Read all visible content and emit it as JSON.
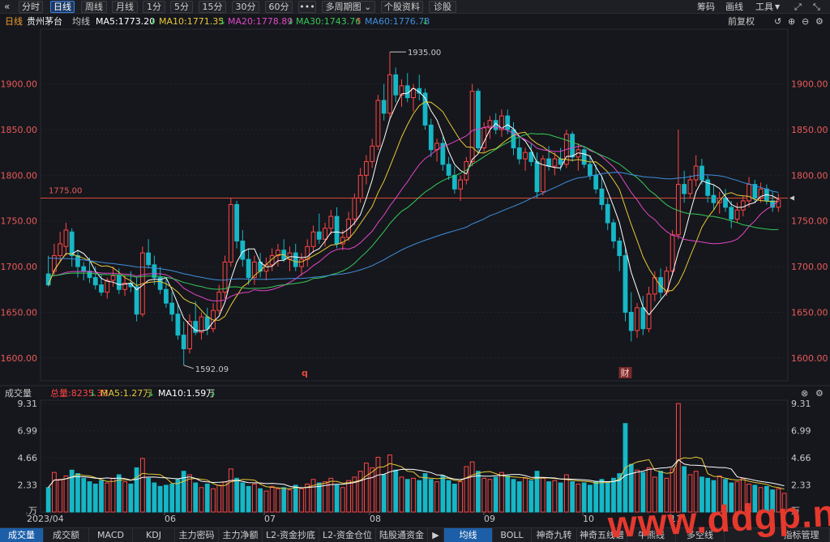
{
  "toolbar": {
    "back": "«",
    "buttons": [
      "分时",
      "日线",
      "周线",
      "月线",
      "1分",
      "5分",
      "15分",
      "30分",
      "60分",
      "•••",
      "多周期图",
      "个股资料",
      "诊股"
    ],
    "multi_arrow": "⌄",
    "right": [
      "筹码",
      "画线",
      "工具"
    ]
  },
  "legend": {
    "period": "日线",
    "name": "贵州茅台",
    "ma_label": "均线",
    "ma5": "MA5:1773.20",
    "ma10": "MA10:1771.35",
    "ma20": "MA20:1778.89",
    "ma30": "MA30:1743.76",
    "ma60": "MA60:1776.78",
    "adjust": "前复权"
  },
  "vol_legend": {
    "title": "成交量",
    "total": "总量:8235.33",
    "ma5": "MA5:1.27万",
    "ma10": "MA10:1.59万"
  },
  "price_axis": [
    "1900.00",
    "1850.00",
    "1800.00",
    "1750.00",
    "1700.00",
    "1650.00",
    "1600.00"
  ],
  "vol_axis": [
    "9.31",
    "6.99",
    "4.66",
    "2.33"
  ],
  "vol_unit": "万",
  "date_axis": [
    "2023/04",
    "06",
    "07",
    "08",
    "09",
    "10",
    "11"
  ],
  "annotations": {
    "high": "1935.00",
    "low": "1592.09",
    "ref": "1775.00",
    "marker_q": "q",
    "marker_cai": "财"
  },
  "bottom_tabs": [
    "成交量",
    "成交额",
    "MACD",
    "KDJ",
    "主力密码",
    "主力净额",
    "L2-资金抄底",
    "L2-资金仓位",
    "陆股通资金",
    "均线",
    "BOLL",
    "神奇九转",
    "神奇五线谱",
    "牛熊线",
    "多空线",
    "指标管理"
  ],
  "watermark": "www.ddgp.net",
  "colors": {
    "up": "#ff4646",
    "down": "#16b7c6",
    "ma5": "#ffffff",
    "ma10": "#e6c83a",
    "ma20": "#e046c8",
    "ma30": "#36c95a",
    "ma60": "#3e8fe0",
    "axis_price": "#e85a5a"
  },
  "chart_data": {
    "type": "candlestick",
    "ylim": [
      1580,
      1960
    ],
    "volume_ylim": [
      0,
      9.31
    ],
    "ref_line": 1775,
    "candles": [
      {
        "o": 1692,
        "h": 1712,
        "l": 1678,
        "c": 1680
      },
      {
        "o": 1695,
        "h": 1725,
        "l": 1690,
        "c": 1712
      },
      {
        "o": 1712,
        "h": 1738,
        "l": 1705,
        "c": 1725
      },
      {
        "o": 1722,
        "h": 1748,
        "l": 1712,
        "c": 1740
      },
      {
        "o": 1738,
        "h": 1742,
        "l": 1700,
        "c": 1712
      },
      {
        "o": 1712,
        "h": 1718,
        "l": 1688,
        "c": 1700
      },
      {
        "o": 1700,
        "h": 1705,
        "l": 1685,
        "c": 1695
      },
      {
        "o": 1695,
        "h": 1710,
        "l": 1682,
        "c": 1688
      },
      {
        "o": 1688,
        "h": 1700,
        "l": 1675,
        "c": 1680
      },
      {
        "o": 1680,
        "h": 1692,
        "l": 1668,
        "c": 1672
      },
      {
        "o": 1672,
        "h": 1688,
        "l": 1665,
        "c": 1685
      },
      {
        "o": 1685,
        "h": 1700,
        "l": 1678,
        "c": 1690
      },
      {
        "o": 1690,
        "h": 1698,
        "l": 1670,
        "c": 1675
      },
      {
        "o": 1675,
        "h": 1690,
        "l": 1668,
        "c": 1682
      },
      {
        "o": 1682,
        "h": 1695,
        "l": 1672,
        "c": 1678
      },
      {
        "o": 1678,
        "h": 1688,
        "l": 1640,
        "c": 1648
      },
      {
        "o": 1648,
        "h": 1722,
        "l": 1645,
        "c": 1715
      },
      {
        "o": 1715,
        "h": 1730,
        "l": 1698,
        "c": 1702
      },
      {
        "o": 1702,
        "h": 1712,
        "l": 1680,
        "c": 1688
      },
      {
        "o": 1688,
        "h": 1700,
        "l": 1670,
        "c": 1675
      },
      {
        "o": 1675,
        "h": 1688,
        "l": 1655,
        "c": 1660
      },
      {
        "o": 1660,
        "h": 1672,
        "l": 1640,
        "c": 1648
      },
      {
        "o": 1648,
        "h": 1660,
        "l": 1620,
        "c": 1625
      },
      {
        "o": 1625,
        "h": 1640,
        "l": 1592,
        "c": 1610
      },
      {
        "o": 1610,
        "h": 1648,
        "l": 1605,
        "c": 1640
      },
      {
        "o": 1640,
        "h": 1662,
        "l": 1625,
        "c": 1628
      },
      {
        "o": 1628,
        "h": 1650,
        "l": 1620,
        "c": 1645
      },
      {
        "o": 1645,
        "h": 1655,
        "l": 1625,
        "c": 1632
      },
      {
        "o": 1632,
        "h": 1660,
        "l": 1628,
        "c": 1652
      },
      {
        "o": 1652,
        "h": 1680,
        "l": 1648,
        "c": 1672
      },
      {
        "o": 1672,
        "h": 1712,
        "l": 1665,
        "c": 1705
      },
      {
        "o": 1705,
        "h": 1775,
        "l": 1700,
        "c": 1768
      },
      {
        "o": 1768,
        "h": 1772,
        "l": 1720,
        "c": 1728
      },
      {
        "o": 1728,
        "h": 1740,
        "l": 1700,
        "c": 1708
      },
      {
        "o": 1708,
        "h": 1720,
        "l": 1680,
        "c": 1688
      },
      {
        "o": 1688,
        "h": 1712,
        "l": 1680,
        "c": 1705
      },
      {
        "o": 1705,
        "h": 1715,
        "l": 1688,
        "c": 1695
      },
      {
        "o": 1695,
        "h": 1710,
        "l": 1685,
        "c": 1702
      },
      {
        "o": 1702,
        "h": 1720,
        "l": 1695,
        "c": 1712
      },
      {
        "o": 1712,
        "h": 1725,
        "l": 1700,
        "c": 1718
      },
      {
        "o": 1718,
        "h": 1730,
        "l": 1705,
        "c": 1708
      },
      {
        "o": 1708,
        "h": 1722,
        "l": 1695,
        "c": 1715
      },
      {
        "o": 1715,
        "h": 1725,
        "l": 1695,
        "c": 1700
      },
      {
        "o": 1700,
        "h": 1715,
        "l": 1690,
        "c": 1708
      },
      {
        "o": 1708,
        "h": 1730,
        "l": 1700,
        "c": 1722
      },
      {
        "o": 1722,
        "h": 1745,
        "l": 1715,
        "c": 1738
      },
      {
        "o": 1738,
        "h": 1758,
        "l": 1725,
        "c": 1730
      },
      {
        "o": 1730,
        "h": 1748,
        "l": 1722,
        "c": 1742
      },
      {
        "o": 1742,
        "h": 1762,
        "l": 1735,
        "c": 1755
      },
      {
        "o": 1755,
        "h": 1765,
        "l": 1720,
        "c": 1725
      },
      {
        "o": 1725,
        "h": 1740,
        "l": 1718,
        "c": 1732
      },
      {
        "o": 1732,
        "h": 1760,
        "l": 1728,
        "c": 1752
      },
      {
        "o": 1752,
        "h": 1780,
        "l": 1745,
        "c": 1775
      },
      {
        "o": 1775,
        "h": 1808,
        "l": 1770,
        "c": 1800
      },
      {
        "o": 1800,
        "h": 1822,
        "l": 1790,
        "c": 1815
      },
      {
        "o": 1815,
        "h": 1840,
        "l": 1808,
        "c": 1832
      },
      {
        "o": 1832,
        "h": 1888,
        "l": 1828,
        "c": 1882
      },
      {
        "o": 1882,
        "h": 1900,
        "l": 1860,
        "c": 1868
      },
      {
        "o": 1868,
        "h": 1935,
        "l": 1862,
        "c": 1910
      },
      {
        "o": 1910,
        "h": 1918,
        "l": 1880,
        "c": 1888
      },
      {
        "o": 1888,
        "h": 1905,
        "l": 1875,
        "c": 1898
      },
      {
        "o": 1898,
        "h": 1912,
        "l": 1880,
        "c": 1885
      },
      {
        "o": 1885,
        "h": 1900,
        "l": 1870,
        "c": 1895
      },
      {
        "o": 1895,
        "h": 1910,
        "l": 1882,
        "c": 1890
      },
      {
        "o": 1890,
        "h": 1895,
        "l": 1850,
        "c": 1855
      },
      {
        "o": 1855,
        "h": 1862,
        "l": 1820,
        "c": 1828
      },
      {
        "o": 1828,
        "h": 1840,
        "l": 1815,
        "c": 1835
      },
      {
        "o": 1835,
        "h": 1842,
        "l": 1805,
        "c": 1812
      },
      {
        "o": 1812,
        "h": 1820,
        "l": 1795,
        "c": 1800
      },
      {
        "o": 1800,
        "h": 1810,
        "l": 1780,
        "c": 1785
      },
      {
        "o": 1785,
        "h": 1800,
        "l": 1772,
        "c": 1795
      },
      {
        "o": 1795,
        "h": 1820,
        "l": 1790,
        "c": 1815
      },
      {
        "o": 1815,
        "h": 1900,
        "l": 1810,
        "c": 1892
      },
      {
        "o": 1892,
        "h": 1895,
        "l": 1825,
        "c": 1830
      },
      {
        "o": 1830,
        "h": 1858,
        "l": 1825,
        "c": 1852
      },
      {
        "o": 1852,
        "h": 1865,
        "l": 1840,
        "c": 1860
      },
      {
        "o": 1860,
        "h": 1868,
        "l": 1845,
        "c": 1850
      },
      {
        "o": 1850,
        "h": 1872,
        "l": 1842,
        "c": 1865
      },
      {
        "o": 1865,
        "h": 1872,
        "l": 1845,
        "c": 1850
      },
      {
        "o": 1850,
        "h": 1858,
        "l": 1822,
        "c": 1830
      },
      {
        "o": 1830,
        "h": 1842,
        "l": 1812,
        "c": 1818
      },
      {
        "o": 1818,
        "h": 1830,
        "l": 1805,
        "c": 1825
      },
      {
        "o": 1825,
        "h": 1835,
        "l": 1810,
        "c": 1815
      },
      {
        "o": 1815,
        "h": 1825,
        "l": 1775,
        "c": 1782
      },
      {
        "o": 1782,
        "h": 1822,
        "l": 1778,
        "c": 1818
      },
      {
        "o": 1818,
        "h": 1832,
        "l": 1805,
        "c": 1810
      },
      {
        "o": 1810,
        "h": 1825,
        "l": 1800,
        "c": 1818
      },
      {
        "o": 1818,
        "h": 1830,
        "l": 1805,
        "c": 1812
      },
      {
        "o": 1812,
        "h": 1850,
        "l": 1808,
        "c": 1845
      },
      {
        "o": 1845,
        "h": 1848,
        "l": 1815,
        "c": 1820
      },
      {
        "o": 1820,
        "h": 1835,
        "l": 1805,
        "c": 1828
      },
      {
        "o": 1828,
        "h": 1832,
        "l": 1808,
        "c": 1812
      },
      {
        "o": 1812,
        "h": 1822,
        "l": 1795,
        "c": 1800
      },
      {
        "o": 1800,
        "h": 1812,
        "l": 1780,
        "c": 1785
      },
      {
        "o": 1785,
        "h": 1800,
        "l": 1762,
        "c": 1768
      },
      {
        "o": 1768,
        "h": 1775,
        "l": 1740,
        "c": 1748
      },
      {
        "o": 1748,
        "h": 1752,
        "l": 1720,
        "c": 1728
      },
      {
        "o": 1728,
        "h": 1732,
        "l": 1695,
        "c": 1712
      },
      {
        "o": 1712,
        "h": 1720,
        "l": 1640,
        "c": 1650
      },
      {
        "o": 1650,
        "h": 1672,
        "l": 1618,
        "c": 1630
      },
      {
        "o": 1630,
        "h": 1660,
        "l": 1622,
        "c": 1655
      },
      {
        "o": 1655,
        "h": 1668,
        "l": 1625,
        "c": 1632
      },
      {
        "o": 1632,
        "h": 1678,
        "l": 1628,
        "c": 1670
      },
      {
        "o": 1670,
        "h": 1695,
        "l": 1662,
        "c": 1688
      },
      {
        "o": 1688,
        "h": 1698,
        "l": 1665,
        "c": 1672
      },
      {
        "o": 1672,
        "h": 1700,
        "l": 1668,
        "c": 1695
      },
      {
        "o": 1695,
        "h": 1740,
        "l": 1690,
        "c": 1735
      },
      {
        "o": 1735,
        "h": 1850,
        "l": 1730,
        "c": 1790
      },
      {
        "o": 1790,
        "h": 1805,
        "l": 1770,
        "c": 1780
      },
      {
        "o": 1780,
        "h": 1800,
        "l": 1775,
        "c": 1795
      },
      {
        "o": 1795,
        "h": 1822,
        "l": 1788,
        "c": 1810
      },
      {
        "o": 1810,
        "h": 1818,
        "l": 1790,
        "c": 1795
      },
      {
        "o": 1795,
        "h": 1800,
        "l": 1770,
        "c": 1778
      },
      {
        "o": 1778,
        "h": 1790,
        "l": 1762,
        "c": 1770
      },
      {
        "o": 1770,
        "h": 1782,
        "l": 1758,
        "c": 1775
      },
      {
        "o": 1775,
        "h": 1785,
        "l": 1760,
        "c": 1765
      },
      {
        "o": 1765,
        "h": 1772,
        "l": 1742,
        "c": 1752
      },
      {
        "o": 1752,
        "h": 1770,
        "l": 1748,
        "c": 1762
      },
      {
        "o": 1762,
        "h": 1778,
        "l": 1755,
        "c": 1772
      },
      {
        "o": 1772,
        "h": 1798,
        "l": 1765,
        "c": 1790
      },
      {
        "o": 1790,
        "h": 1795,
        "l": 1770,
        "c": 1775
      },
      {
        "o": 1775,
        "h": 1792,
        "l": 1770,
        "c": 1785
      },
      {
        "o": 1785,
        "h": 1790,
        "l": 1768,
        "c": 1772
      },
      {
        "o": 1772,
        "h": 1782,
        "l": 1760,
        "c": 1765
      },
      {
        "o": 1765,
        "h": 1780,
        "l": 1760,
        "c": 1773
      }
    ],
    "volumes": [
      2.1,
      3.4,
      2.8,
      3.1,
      3.6,
      3.3,
      2.9,
      2.6,
      2.4,
      2.7,
      2.5,
      2.9,
      3.2,
      2.6,
      2.4,
      3.8,
      4.6,
      2.9,
      2.5,
      2.2,
      2.3,
      2.4,
      2.8,
      3.5,
      3.2,
      2.5,
      2.1,
      2.4,
      2.0,
      2.3,
      2.6,
      3.7,
      2.9,
      2.5,
      2.2,
      2.4,
      2.0,
      1.8,
      2.2,
      2.0,
      2.1,
      1.9,
      2.3,
      2.0,
      2.4,
      2.8,
      2.5,
      2.6,
      2.9,
      2.3,
      2.1,
      2.7,
      3.0,
      3.5,
      4.2,
      3.8,
      4.7,
      3.2,
      4.9,
      3.6,
      3.0,
      2.8,
      2.9,
      2.7,
      3.3,
      2.8,
      2.6,
      3.1,
      2.7,
      2.4,
      2.6,
      3.9,
      4.3,
      3.5,
      2.9,
      2.8,
      3.0,
      3.4,
      3.1,
      2.8,
      2.6,
      2.9,
      2.7,
      3.5,
      2.9,
      2.6,
      2.7,
      2.5,
      3.2,
      2.6,
      2.4,
      2.5,
      2.3,
      2.6,
      2.8,
      2.5,
      2.9,
      3.3,
      7.6,
      4.1,
      3.6,
      3.4,
      3.8,
      3.0,
      3.5,
      2.9,
      3.7,
      9.31,
      3.9,
      3.2,
      3.5,
      3.0,
      2.9,
      2.7,
      3.1,
      2.8,
      2.5,
      2.6,
      2.9,
      2.4,
      2.3,
      2.1,
      2.2,
      1.9,
      2.0,
      1.6
    ]
  }
}
